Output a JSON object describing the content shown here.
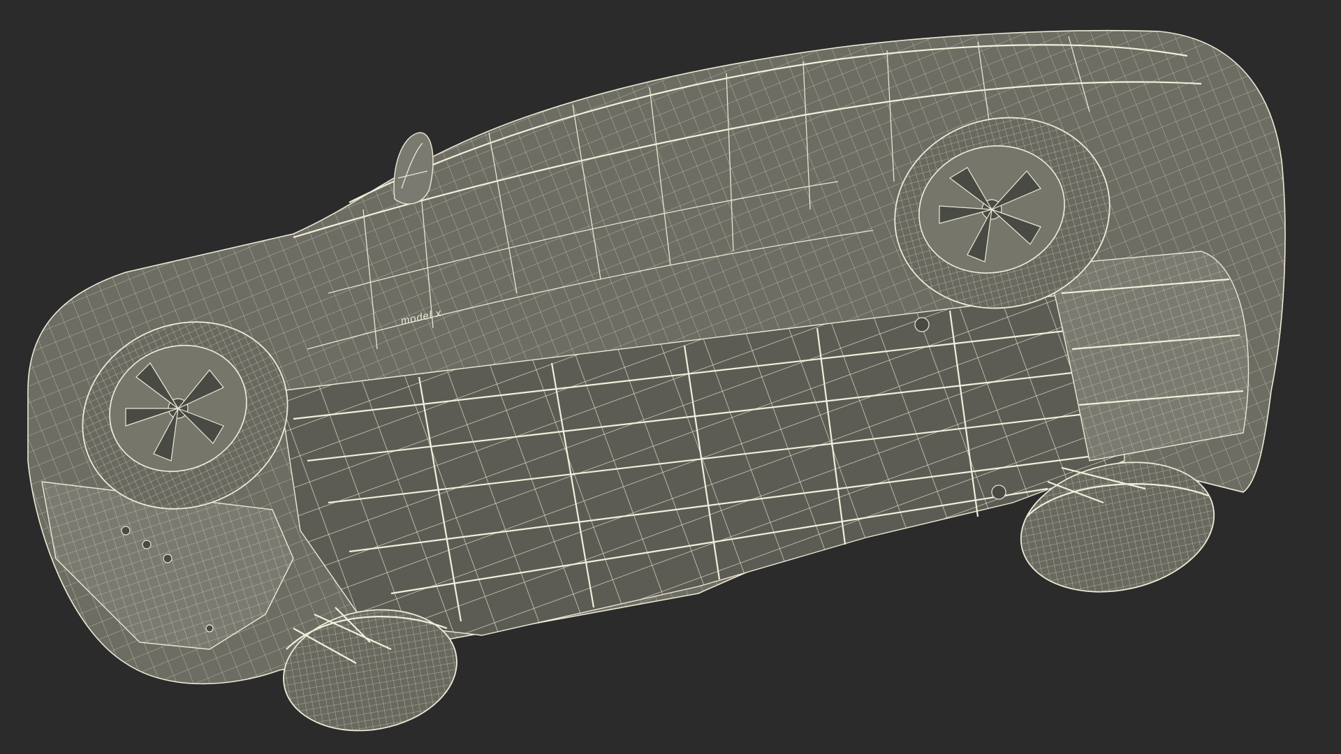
{
  "scene": {
    "background_color": "#2b2b2b",
    "wire_color": "#ece9d6",
    "surface_color": "#6e6d63"
  },
  "badge": {
    "text": "model x"
  }
}
